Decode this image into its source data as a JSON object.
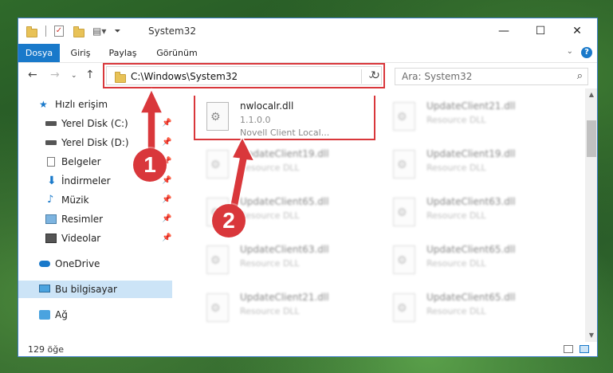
{
  "window": {
    "title": "System32",
    "controls": {
      "minimize": "—",
      "maximize": "☐",
      "close": "✕"
    }
  },
  "ribbon": {
    "tabs": [
      "Dosya",
      "Giriş",
      "Paylaş",
      "Görünüm"
    ],
    "help": "?"
  },
  "address": {
    "path": "C:\\Windows\\System32",
    "search_placeholder": "Ara: System32"
  },
  "nav": {
    "quick_access": "Hızlı erişim",
    "items": [
      {
        "label": "Yerel Disk (C:)",
        "icon": "drive-icon",
        "pinned": true
      },
      {
        "label": "Yerel Disk (D:)",
        "icon": "drive-icon",
        "pinned": true
      },
      {
        "label": "Belgeler",
        "icon": "documents-icon",
        "pinned": true
      },
      {
        "label": "İndirmeler",
        "icon": "downloads-icon",
        "pinned": true
      },
      {
        "label": "Müzik",
        "icon": "music-icon",
        "pinned": true
      },
      {
        "label": "Resimler",
        "icon": "pictures-icon",
        "pinned": true
      },
      {
        "label": "Videolar",
        "icon": "videos-icon",
        "pinned": true
      }
    ],
    "onedrive": "OneDrive",
    "this_pc": "Bu bilgisayar",
    "network": "Ağ"
  },
  "files": {
    "highlighted": {
      "name": "nwlocalr.dll",
      "version": "1.1.0.0",
      "description": "Novell Client Local..."
    },
    "others": [
      {
        "name": "UpdateClient21.dll",
        "type": "Resource DLL"
      },
      {
        "name": "UpdateClient19.dll",
        "type": "Resource DLL"
      },
      {
        "name": "UpdateClient19.dll",
        "type": "Resource DLL"
      },
      {
        "name": "UpdateClient65.dll",
        "type": "Resource DLL"
      },
      {
        "name": "UpdateClient63.dll",
        "type": "Resource DLL"
      },
      {
        "name": "UpdateClient63.dll",
        "type": "Resource DLL"
      },
      {
        "name": "UpdateClient65.dll",
        "type": "Resource DLL"
      },
      {
        "name": "UpdateClient21.dll",
        "type": "Resource DLL"
      },
      {
        "name": "UpdateClient65.dll",
        "type": "Resource DLL"
      }
    ]
  },
  "status": {
    "item_count": "129 öğe"
  },
  "annotations": {
    "step1": "1",
    "step2": "2",
    "color": "#d9373b"
  }
}
